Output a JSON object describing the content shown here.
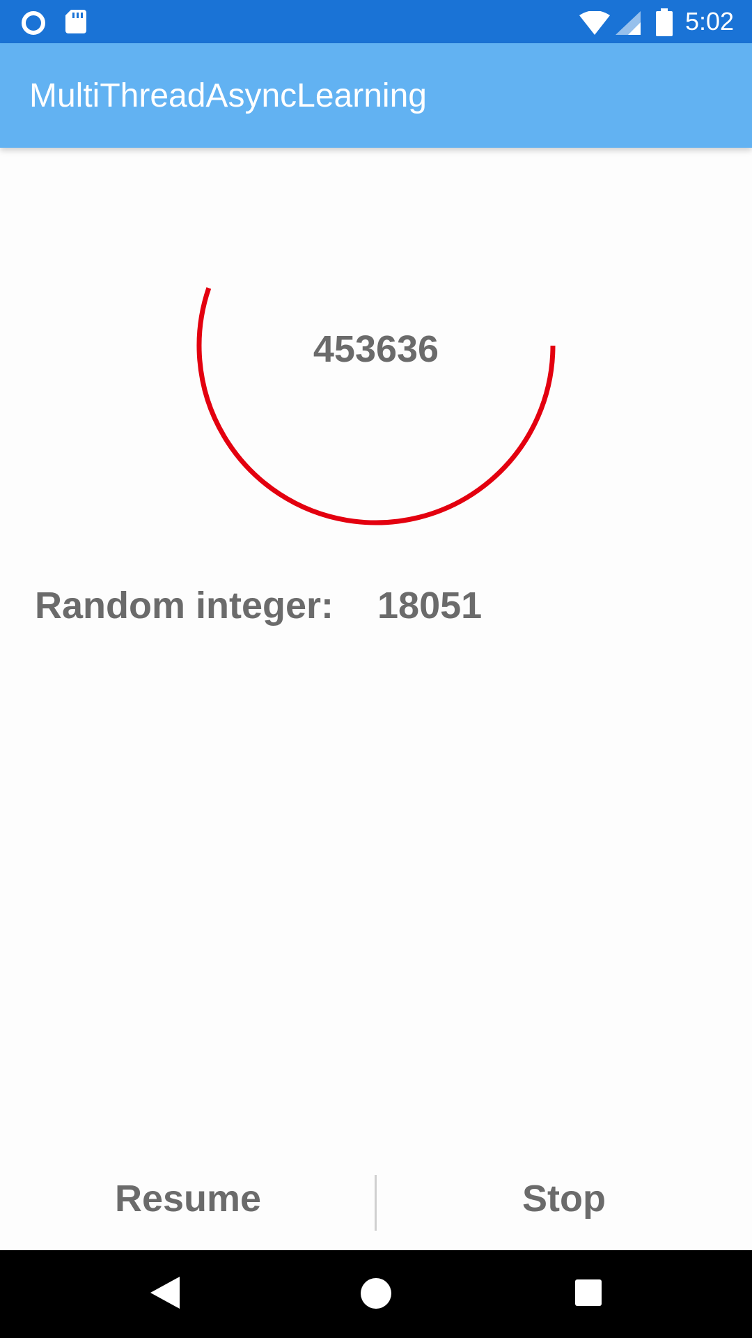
{
  "status_bar": {
    "time": "5:02",
    "icons": [
      "circle-notification-icon",
      "sd-card-icon",
      "wifi-icon",
      "cell-signal-icon",
      "battery-icon"
    ]
  },
  "app_bar": {
    "title": "MultiThreadAsyncLearning"
  },
  "progress": {
    "counter_value": "453636",
    "ring_color": "#e3000f"
  },
  "random": {
    "label": "Random integer:",
    "value": "18051"
  },
  "buttons": {
    "resume_label": "Resume",
    "stop_label": "Stop"
  },
  "nav_bar": {
    "icons": [
      "back-icon",
      "home-icon",
      "recents-icon"
    ]
  },
  "colors": {
    "status_bar": "#1a73d6",
    "app_bar": "#62b2f2",
    "text_gray": "#6b6b6b",
    "nav_bar": "#000000"
  }
}
